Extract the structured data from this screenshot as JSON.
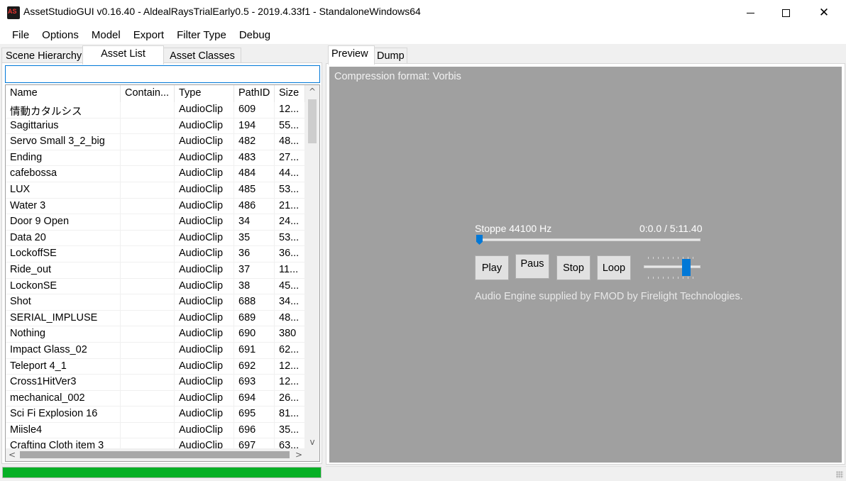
{
  "window": {
    "title": "AssetStudioGUI v0.16.40 - AldealRaysTrialEarly0.5 - 2019.4.33f1 - StandaloneWindows64",
    "app_icon": "assetstudio-icon",
    "minimize_icon": "minimize-icon",
    "maximize_icon": "maximize-icon",
    "close_icon": "close-icon",
    "close_glyph": "✕"
  },
  "menu": [
    "File",
    "Options",
    "Model",
    "Export",
    "Filter Type",
    "Debug"
  ],
  "left_tabs": {
    "scene": "Scene Hierarchy",
    "asset_list": "Asset List",
    "asset_classes": "Asset Classes",
    "active": "Asset List"
  },
  "filter": {
    "value": "",
    "placeholder": ""
  },
  "table": {
    "columns": [
      "Name",
      "Contain...",
      "Type",
      "PathID",
      "Size"
    ],
    "rows": [
      [
        "情動カタルシス",
        "",
        "AudioClip",
        "609",
        "12..."
      ],
      [
        "Sagittarius",
        "",
        "AudioClip",
        "194",
        "55..."
      ],
      [
        "Servo Small 3_2_big",
        "",
        "AudioClip",
        "482",
        "48..."
      ],
      [
        "Ending",
        "",
        "AudioClip",
        "483",
        "27..."
      ],
      [
        "cafebossa",
        "",
        "AudioClip",
        "484",
        "44..."
      ],
      [
        "LUX",
        "",
        "AudioClip",
        "485",
        "53..."
      ],
      [
        "Water 3",
        "",
        "AudioClip",
        "486",
        "21..."
      ],
      [
        "Door 9 Open",
        "",
        "AudioClip",
        "34",
        "24..."
      ],
      [
        "Data 20",
        "",
        "AudioClip",
        "35",
        "53..."
      ],
      [
        "LockoffSE",
        "",
        "AudioClip",
        "36",
        "36..."
      ],
      [
        "Ride_out",
        "",
        "AudioClip",
        "37",
        "11..."
      ],
      [
        "LockonSE",
        "",
        "AudioClip",
        "38",
        "45..."
      ],
      [
        "Shot",
        "",
        "AudioClip",
        "688",
        "34..."
      ],
      [
        "SERIAL_IMPLUSE",
        "",
        "AudioClip",
        "689",
        "48..."
      ],
      [
        "Nothing",
        "",
        "AudioClip",
        "690",
        "380"
      ],
      [
        "Impact Glass_02",
        "",
        "AudioClip",
        "691",
        "62..."
      ],
      [
        "Teleport 4_1",
        "",
        "AudioClip",
        "692",
        "12..."
      ],
      [
        "Cross1HitVer3",
        "",
        "AudioClip",
        "693",
        "12..."
      ],
      [
        "mechanical_002",
        "",
        "AudioClip",
        "694",
        "26..."
      ],
      [
        "Sci Fi Explosion 16",
        "",
        "AudioClip",
        "695",
        "81..."
      ],
      [
        "Miisle4",
        "",
        "AudioClip",
        "696",
        "35..."
      ],
      [
        "Crafting Cloth item 3",
        "",
        "AudioClip",
        "697",
        "63..."
      ]
    ],
    "scroll_up_glyph": "^",
    "scroll_down_glyph": "v",
    "scroll_left_glyph": "<",
    "scroll_right_glyph": ">"
  },
  "progress": {
    "fraction": 1.0,
    "color": "#06b025"
  },
  "right_tabs": {
    "preview": "Preview",
    "dump": "Dump",
    "active": "Preview"
  },
  "preview": {
    "compression": "Compression format: Vorbis",
    "background": "#a0a0a0",
    "audio": {
      "status": "Stoppe 44100 Hz",
      "time": "0:0.0 / 5:11.40",
      "seek_fraction": 0.0,
      "volume_fraction": 0.8,
      "play": "Play",
      "pause": "Paus",
      "stop": "Stop",
      "loop": "Loop",
      "engine": "Audio Engine supplied by FMOD by Firelight Technologies."
    }
  }
}
